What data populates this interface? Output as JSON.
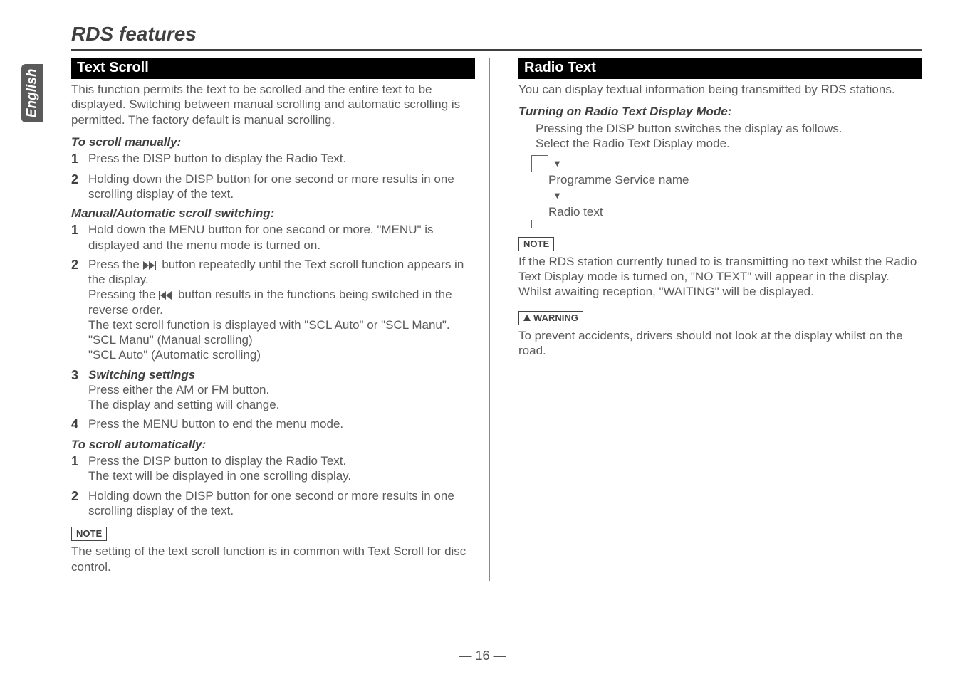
{
  "side_tab": "English",
  "title": "RDS features",
  "left": {
    "section_head": "Text Scroll",
    "intro": "This function permits the text to be scrolled and the entire text to be displayed. Switching between manual scrolling and automatic scrolling is permitted. The factory default is manual scrolling.",
    "scroll_manually_head": "To scroll manually:",
    "sm1": "Press the DISP button to display the Radio Text.",
    "sm2": "Holding down the DISP button for one second or more results in one scrolling display of the text.",
    "ma_head": "Manual/Automatic scroll switching:",
    "ma1": "Hold down the MENU button for one second or more. \"MENU\" is displayed and the menu mode is turned on.",
    "ma2_a": "Press the ",
    "ma2_b": " button repeatedly until the Text scroll function appears in the display.",
    "ma2_c": "Pressing the ",
    "ma2_d": " button results in the functions being switched in the reverse order.",
    "ma2_e": "The text scroll function is displayed with \"SCL Auto\" or \"SCL Manu\".",
    "ma2_f": "\"SCL Manu\" (Manual scrolling)",
    "ma2_g": "\"SCL Auto\" (Automatic scrolling)",
    "ma3_head": "Switching settings",
    "ma3_a": "Press either the AM or FM button.",
    "ma3_b": "The display and setting will change.",
    "ma4": "Press the MENU button to end the menu mode.",
    "auto_head": "To scroll automatically:",
    "au1_a": "Press the DISP button to display the Radio Text.",
    "au1_b": "The text will be displayed in one scrolling display.",
    "au2": "Holding down the DISP button for one second or more results in one scrolling display of the text.",
    "note_label": "NOTE",
    "note_body": "The setting of the text scroll function is in common with Text Scroll for disc control."
  },
  "right": {
    "section_head": "Radio Text",
    "intro": "You can display textual information being transmitted by RDS stations.",
    "turn_on_head": "Turning on Radio Text Display Mode:",
    "turn_on_a": "Pressing the DISP button switches the display as follows.",
    "turn_on_b": "Select the Radio Text Display mode.",
    "diag_1": "Programme Service name",
    "diag_2": "Radio text",
    "note_label": "NOTE",
    "note_body": "If the RDS station currently tuned to is transmitting no text whilst the Radio Text Display mode is turned on, \"NO TEXT\" will appear in the display. Whilst awaiting reception, \"WAITING\" will be displayed.",
    "warn_label": "WARNING",
    "warn_body": "To prevent accidents, drivers should not look at the display whilst on the road."
  },
  "page_number": "— 16 —"
}
